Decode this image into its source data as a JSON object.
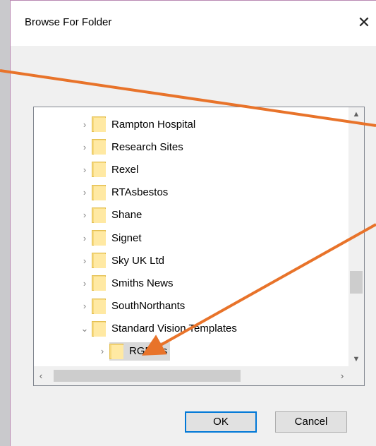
{
  "dialog": {
    "title": "Browse For Folder",
    "close_glyph": "✕",
    "ok_label": "OK",
    "cancel_label": "Cancel"
  },
  "tree": {
    "items": [
      {
        "label": "Rampton Hospital",
        "expander": "›"
      },
      {
        "label": "Research Sites",
        "expander": "›"
      },
      {
        "label": "Rexel",
        "expander": "›"
      },
      {
        "label": "RTAsbestos",
        "expander": "›"
      },
      {
        "label": "Shane",
        "expander": "›"
      },
      {
        "label": "Signet",
        "expander": "›"
      },
      {
        "label": "Sky UK Ltd",
        "expander": "›"
      },
      {
        "label": "Smiths News",
        "expander": "›"
      },
      {
        "label": "SouthNorthants",
        "expander": "›"
      },
      {
        "label": "Standard Vision Templates",
        "expander": "⌄"
      },
      {
        "label": "RGFiles",
        "expander": "›"
      }
    ]
  },
  "scrollbars": {
    "up": "▲",
    "down": "▼",
    "left": "‹",
    "right": "›"
  },
  "colors": {
    "annotation_arrow": "#e8732a",
    "ok_focus_border": "#0078d7",
    "folder": "#f7d97d"
  }
}
